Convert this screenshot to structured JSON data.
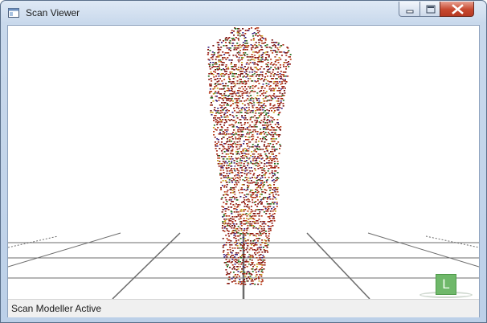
{
  "window": {
    "title": "Scan Viewer",
    "controls": {
      "minimize_icon": "minimize-icon",
      "maximize_icon": "maximize-icon",
      "close_icon": "close-icon"
    }
  },
  "viewport": {
    "model": "scan-point-cloud",
    "point_colors": [
      "#8b0f0a",
      "#a3220e",
      "#6e0b07",
      "#b5350f",
      "#1f6a1a",
      "#3a1e7a",
      "#c8a21a"
    ],
    "grid_color": "#6b6b6b",
    "background": "#ffffff",
    "light_indicator": {
      "label": "L",
      "color": "#6fb86a"
    }
  },
  "statusbar": {
    "text": "Scan Modeller Active"
  }
}
